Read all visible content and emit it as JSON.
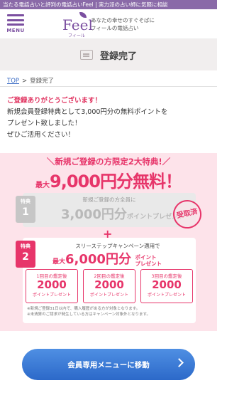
{
  "top_strip": "当たる電話占いと評判の電話占いFeel | 実力派の占い師に気軽に相談",
  "header": {
    "menu_label": "MENU",
    "logo_word": "Feel",
    "logo_sub": "フィール",
    "tagline_1": "あなたの幸せのすぐそばに",
    "tagline_2": "フィールの電話占い"
  },
  "page_title": "登録完了",
  "breadcrumb": {
    "top": "TOP",
    "sep": ">",
    "current": "登録完了"
  },
  "message": {
    "thanks": "ご登録ありがとうございます！",
    "line2": "新規会員登録特典として3,000円分の無料ポイントを",
    "line3": "プレゼント致しました！",
    "line4": "ぜひご活用ください！"
  },
  "campaign": {
    "headline": "＼新規ご登録の方限定2大特典!／",
    "max_label": "最大",
    "big_amount": "9,000円分",
    "free_label": "無料！",
    "perk1": {
      "label": "特典",
      "num": "1",
      "text": "新規ご登録の方全員に",
      "amount": "3,000円分",
      "sub": "ポイントプレゼント",
      "stamp": "受取済"
    },
    "plus": "+",
    "perk2": {
      "label": "特典",
      "num": "2",
      "text": "スリーステップキャンペーン適用で",
      "max": "最大",
      "amount": "6,000円分",
      "sub1": "ポイント",
      "sub2": "プレゼント",
      "steps": [
        {
          "head": "1回目の鑑定後",
          "amount": "2000",
          "foot": "ポイントプレゼント"
        },
        {
          "head": "2回目の鑑定後",
          "amount": "2000",
          "foot": "ポイントプレゼント"
        },
        {
          "head": "3回目の鑑定後",
          "amount": "2000",
          "foot": "ポイントプレゼント"
        }
      ],
      "note1": "※新規ご登録31日以内で、購入履歴がある方が対象となります。",
      "note2": "※未清算のご請求が発生している方はキャンペーン対象外となります。"
    }
  },
  "cta": {
    "label": "会員専用メニューに移動"
  }
}
